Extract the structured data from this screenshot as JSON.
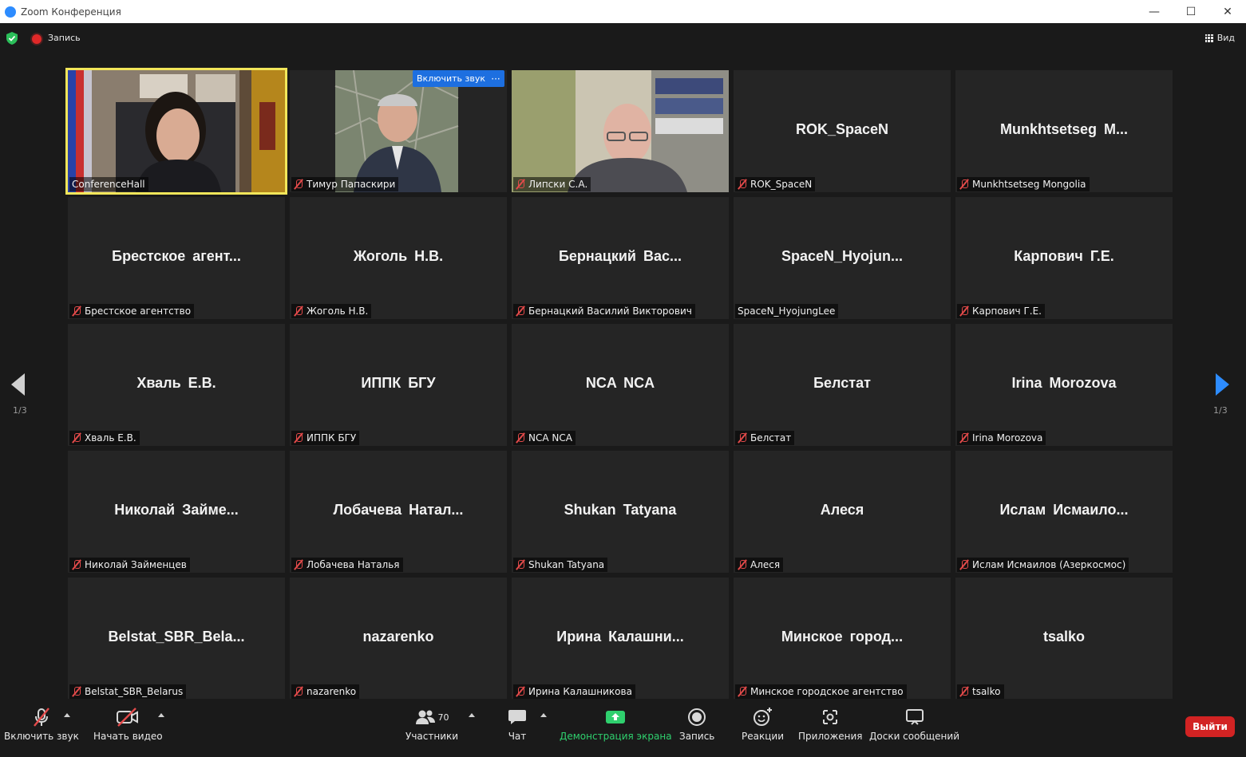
{
  "window": {
    "title": "Zoom Конференция",
    "minimize": "—",
    "maximize": "☐",
    "close": "✕"
  },
  "topbar": {
    "recording_label": "Запись",
    "view_label": "Вид"
  },
  "pagination": {
    "left": "1/3",
    "right": "1/3"
  },
  "overlay": {
    "unmute_label": "Включить звук",
    "more_label": "···"
  },
  "tiles": [
    {
      "center": "",
      "tag": "ConferenceHall",
      "muted": false,
      "video": "woman",
      "active": true
    },
    {
      "center": "",
      "tag": "Тимур Папаскири",
      "muted": true,
      "video": "man-map",
      "active": false
    },
    {
      "center": "",
      "tag": "Липски С.А.",
      "muted": true,
      "video": "man-office",
      "active": false
    },
    {
      "center": "ROK_SpaceN",
      "tag": "ROK_SpaceN",
      "muted": true,
      "video": "",
      "active": false
    },
    {
      "center": "Munkhtsetseg  M...",
      "tag": "Munkhtsetseg Mongolia",
      "muted": true,
      "video": "",
      "active": false
    },
    {
      "center": "Брестское  агент...",
      "tag": "Брестское агентство",
      "muted": true,
      "video": "",
      "active": false
    },
    {
      "center": "Жоголь Н.В.",
      "tag": "Жоголь Н.В.",
      "muted": true,
      "video": "",
      "active": false
    },
    {
      "center": "Бернацкий  Вас...",
      "tag": "Бернацкий Василий Викторович",
      "muted": true,
      "video": "",
      "active": false
    },
    {
      "center": "SpaceN_Hyojun...",
      "tag": "SpaceN_HyojungLee",
      "muted": false,
      "video": "",
      "active": false
    },
    {
      "center": "Карпович Г.Е.",
      "tag": "Карпович Г.Е.",
      "muted": true,
      "video": "",
      "active": false
    },
    {
      "center": "Хваль Е.В.",
      "tag": "Хваль Е.В.",
      "muted": true,
      "video": "",
      "active": false
    },
    {
      "center": "ИППК БГУ",
      "tag": "ИППК БГУ",
      "muted": true,
      "video": "",
      "active": false
    },
    {
      "center": "NCA NCA",
      "tag": "NCA NCA",
      "muted": true,
      "video": "",
      "active": false
    },
    {
      "center": "Белстат",
      "tag": "Белстат",
      "muted": true,
      "video": "",
      "active": false
    },
    {
      "center": "Irina Morozova",
      "tag": "Irina Morozova",
      "muted": true,
      "video": "",
      "active": false
    },
    {
      "center": "Николай  Займе...",
      "tag": "Николай Займенцев",
      "muted": true,
      "video": "",
      "active": false
    },
    {
      "center": "Лобачева  Натал...",
      "tag": "Лобачева Наталья",
      "muted": true,
      "video": "",
      "active": false
    },
    {
      "center": "Shukan Tatyana",
      "tag": "Shukan Tatyana",
      "muted": true,
      "video": "",
      "active": false
    },
    {
      "center": "Алеся",
      "tag": "Алеся",
      "muted": true,
      "video": "",
      "active": false
    },
    {
      "center": "Ислам  Исмаило...",
      "tag": "Ислам Исмаилов (Азеркосмос)",
      "muted": true,
      "video": "",
      "active": false
    },
    {
      "center": "Belstat_SBR_Bela...",
      "tag": "Belstat_SBR_Belarus",
      "muted": true,
      "video": "",
      "active": false
    },
    {
      "center": "nazarenko",
      "tag": "nazarenko",
      "muted": true,
      "video": "",
      "active": false
    },
    {
      "center": "Ирина  Калашни...",
      "tag": "Ирина Калашникова",
      "muted": true,
      "video": "",
      "active": false
    },
    {
      "center": "Минское  город...",
      "tag": "Минское городское агентство",
      "muted": true,
      "video": "",
      "active": false
    },
    {
      "center": "tsalko",
      "tag": "tsalko",
      "muted": true,
      "video": "",
      "active": false
    }
  ],
  "toolbar": {
    "unmute": "Включить звук",
    "start_video": "Начать видео",
    "participants": "Участники",
    "participants_count": "70",
    "chat": "Чат",
    "share": "Демонстрация экрана",
    "record": "Запись",
    "reactions": "Реакции",
    "apps": "Приложения",
    "whiteboards": "Доски сообщений",
    "leave": "Выйти"
  },
  "colors": {
    "accent": "#2d8cff",
    "active_border": "#f2e65a",
    "leave": "#d22323",
    "share_green": "#2fd06e",
    "muted_red": "#e34a4a"
  }
}
